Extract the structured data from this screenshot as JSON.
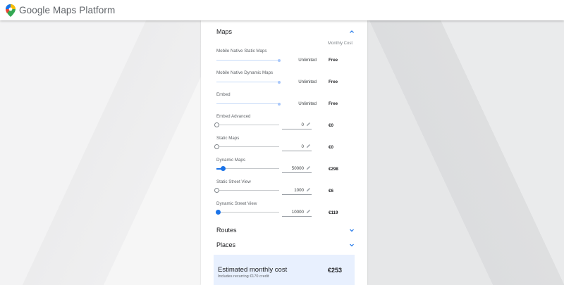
{
  "header": {
    "brand": "Google Maps Platform"
  },
  "sections": {
    "maps": {
      "title": "Maps",
      "column_header": "Monthly Cost"
    },
    "routes": {
      "title": "Routes"
    },
    "places": {
      "title": "Places"
    }
  },
  "products": [
    {
      "name": "Mobile Native Static Maps",
      "quantity": "Unlimited",
      "cost": "Free",
      "slider_fraction": 1.0,
      "type": "unlimited"
    },
    {
      "name": "Mobile Native Dynamic Maps",
      "quantity": "Unlimited",
      "cost": "Free",
      "slider_fraction": 1.0,
      "type": "unlimited"
    },
    {
      "name": "Embed",
      "quantity": "Unlimited",
      "cost": "Free",
      "slider_fraction": 1.0,
      "type": "unlimited"
    },
    {
      "name": "Embed Advanced",
      "quantity": "0",
      "cost": "€0",
      "slider_fraction": 0.0,
      "type": "input"
    },
    {
      "name": "Static Maps",
      "quantity": "0",
      "cost": "€0",
      "slider_fraction": 0.0,
      "type": "input"
    },
    {
      "name": "Dynamic Maps",
      "quantity": "50000",
      "cost": "€298",
      "slider_fraction": 0.1,
      "type": "input"
    },
    {
      "name": "Static Street View",
      "quantity": "1000",
      "cost": "€6",
      "slider_fraction": 0.0,
      "type": "input"
    },
    {
      "name": "Dynamic Street View",
      "quantity": "10000",
      "cost": "€119",
      "slider_fraction": 0.02,
      "type": "input"
    }
  ],
  "estimate": {
    "title": "Estimated monthly cost",
    "subtitle": "Includes recurring €170 credit",
    "value": "€253"
  },
  "colors": {
    "accent": "#1a73e8",
    "estimate_bg": "#e8f0fe"
  },
  "icons": [
    "maps-logo-icon",
    "chevron-up-icon",
    "chevron-down-icon",
    "pencil-icon"
  ]
}
